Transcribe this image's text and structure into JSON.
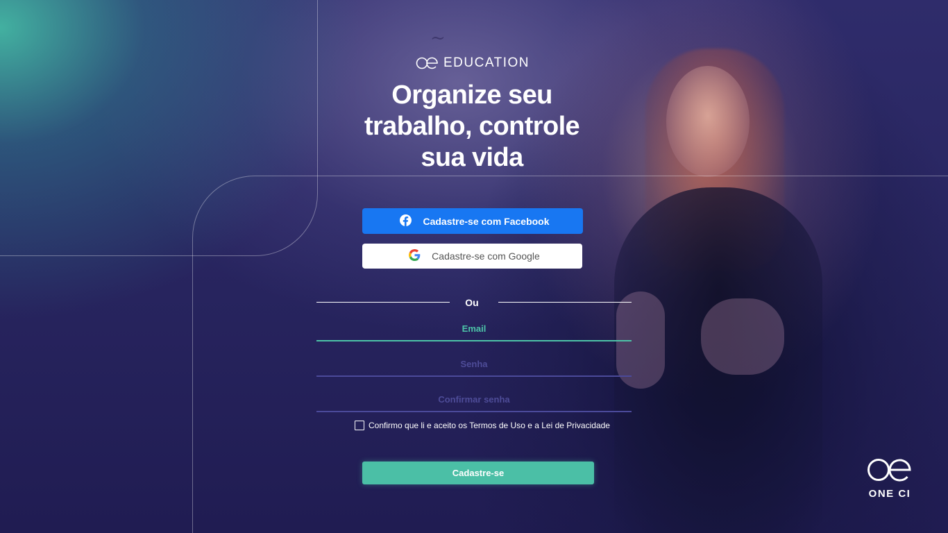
{
  "brand": {
    "logo_icon": "oe-logo-icon",
    "name": "EDUCATION"
  },
  "headline": {
    "line1": "Organize seu",
    "line2": "trabalho, controle",
    "line3": "sua vida"
  },
  "social": {
    "facebook_label": "Cadastre-se com Facebook",
    "facebook_icon": "facebook-icon",
    "facebook_color": "#1877f2",
    "google_label": "Cadastre-se com Google",
    "google_icon": "google-icon"
  },
  "divider": {
    "label": "Ou"
  },
  "form": {
    "email_placeholder": "Email",
    "email_value": "",
    "password_placeholder": "Senha",
    "password_value": "",
    "confirm_placeholder": "Confirmar senha",
    "confirm_value": "",
    "terms_label": "Confirmo que li e aceito os Termos de Uso e a Lei de Privacidade",
    "terms_checked": false,
    "submit_label": "Cadastre-se",
    "accent_color": "#4bbfa6",
    "inactive_line_color": "#4b4a9a"
  },
  "corner_logo": {
    "icon": "oe-logo-icon",
    "text": "ONE CI"
  }
}
